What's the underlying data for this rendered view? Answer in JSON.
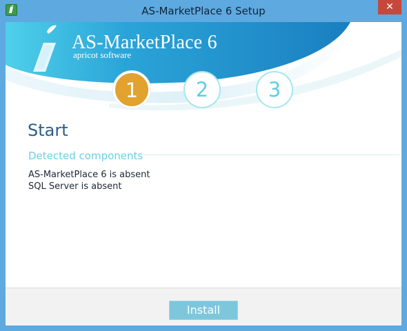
{
  "window": {
    "title": "AS-MarketPlace 6 Setup",
    "close_glyph": "✕",
    "app_icon": "app-icon"
  },
  "banner": {
    "brand_name": "AS-MarketPlace 6",
    "brand_sub": "apricot software",
    "logo_icon": "apricot-logo-icon"
  },
  "steps": [
    {
      "label": "1",
      "state": "active"
    },
    {
      "label": "2",
      "state": "inactive"
    },
    {
      "label": "3",
      "state": "inactive"
    }
  ],
  "main": {
    "title": "Start",
    "section_header": "Detected components",
    "components": [
      "AS-MarketPlace 6 is absent",
      "SQL Server is absent"
    ]
  },
  "footer": {
    "install_label": "Install"
  },
  "colors": {
    "frame": "#5da9e0",
    "banner_blue": "#1d89c4",
    "banner_cyan": "#45c6e4",
    "step_active": "#e2a22f",
    "step_inactive": "#5ecfe0",
    "title_blue": "#2b5d8a",
    "section_cyan": "#6ad0e0",
    "button": "#7dc7dd",
    "close_red": "#c7473d"
  }
}
